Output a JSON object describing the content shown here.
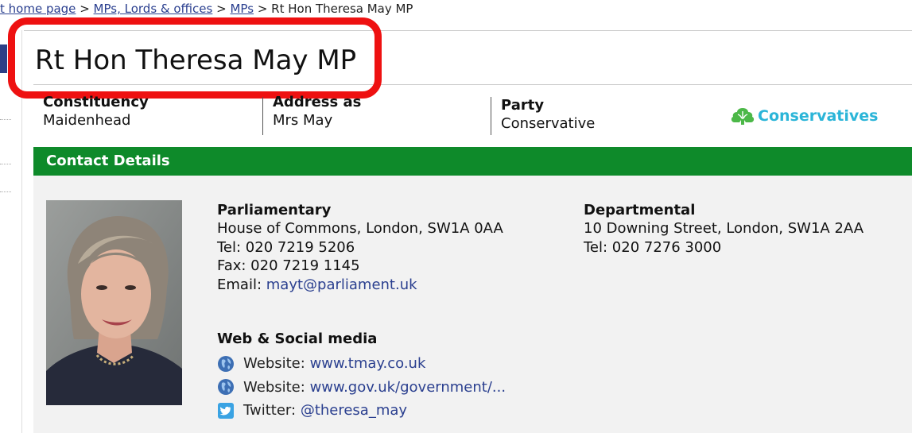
{
  "breadcrumb": {
    "crumb1": "t home page",
    "crumb2": "MPs, Lords & offices",
    "crumb3": "MPs",
    "current": "Rt Hon Theresa May MP",
    "separator": ">"
  },
  "page": {
    "title": "Rt Hon Theresa May MP"
  },
  "info": {
    "constituency": {
      "label": "Constituency",
      "value": "Maidenhead"
    },
    "address_as": {
      "label": "Address as",
      "value": "Mrs May"
    },
    "party": {
      "label": "Party",
      "value": "Conservative"
    },
    "party_logo_text": "Conservatives"
  },
  "contact": {
    "header": "Contact Details",
    "parliamentary": {
      "title": "Parliamentary",
      "address": "House of Commons, London, SW1A 0AA",
      "tel": "Tel: 020 7219 5206",
      "fax": "Fax: 020 7219 1145",
      "email_label": "Email:",
      "email": "mayt@parliament.uk"
    },
    "departmental": {
      "title": "Departmental",
      "address": "10 Downing Street, London, SW1A 2AA",
      "tel": "Tel: 020 7276 3000"
    },
    "web_social": {
      "title": "Web & Social media",
      "items": [
        {
          "icon": "globe-icon",
          "label": "Website:",
          "link": "www.tmay.co.uk"
        },
        {
          "icon": "globe-icon",
          "label": "Website:",
          "link": "www.gov.uk/government/..."
        },
        {
          "icon": "twitter-icon",
          "label": "Twitter:",
          "link": "@theresa_may"
        }
      ]
    }
  },
  "colors": {
    "accent_green": "#0e8a2a",
    "link_blue": "#2a3f8f",
    "highlight_red": "#ee1111",
    "conservative_blue": "#2bb5d8",
    "conservative_green": "#4cb848"
  }
}
